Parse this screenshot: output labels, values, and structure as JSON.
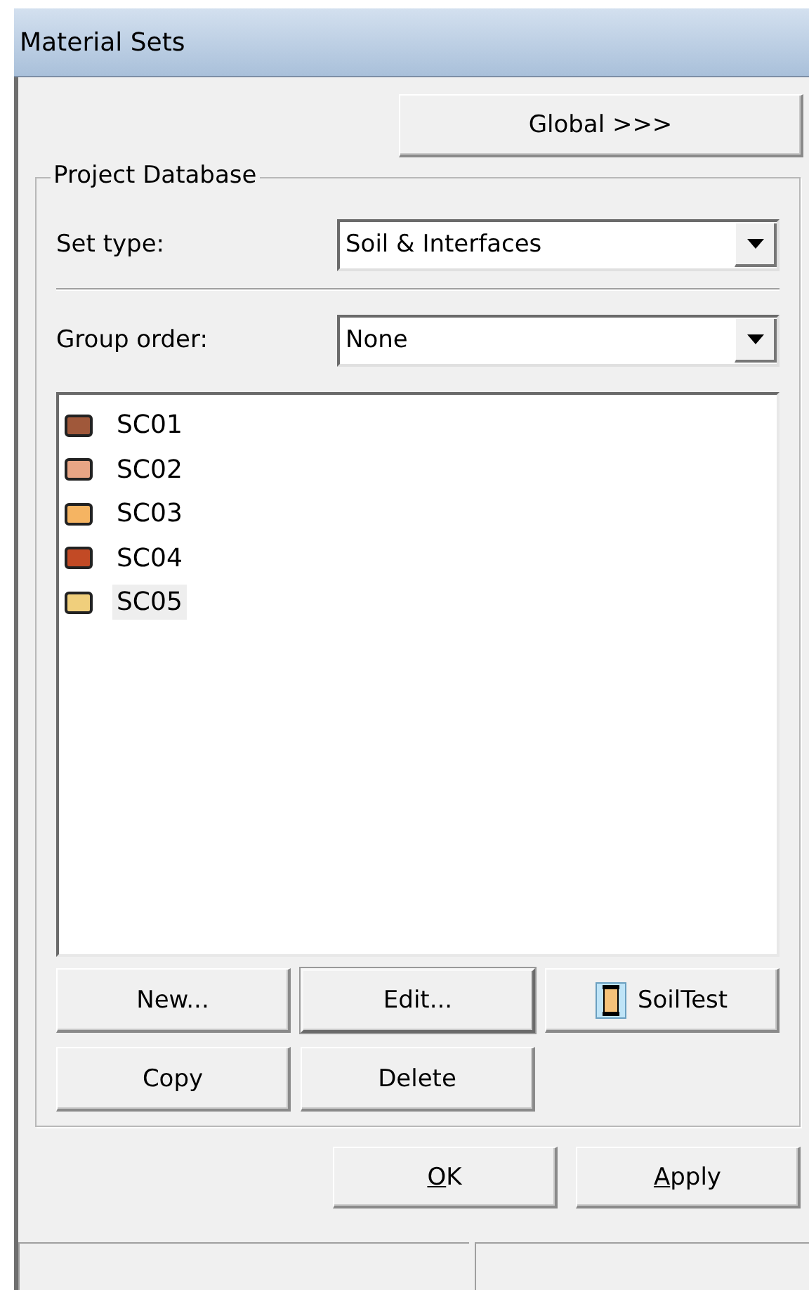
{
  "window": {
    "title": "Material Sets"
  },
  "global_button": "Global >>>",
  "group": {
    "title": "Project Database",
    "set_type": {
      "label": "Set type:",
      "value": "Soil & Interfaces"
    },
    "group_order": {
      "label": "Group order:",
      "value": "None"
    },
    "materials": [
      {
        "name": "SC01",
        "color": "#a0583a",
        "selected": false
      },
      {
        "name": "SC02",
        "color": "#e8a585",
        "selected": false
      },
      {
        "name": "SC03",
        "color": "#f5b462",
        "selected": false
      },
      {
        "name": "SC04",
        "color": "#c24a25",
        "selected": false
      },
      {
        "name": "SC05",
        "color": "#f0cf7c",
        "selected": true
      }
    ],
    "buttons": [
      {
        "label": "New...",
        "kind": "plain",
        "default": false
      },
      {
        "label": "Edit...",
        "kind": "plain",
        "default": true
      },
      {
        "label": "SoilTest",
        "kind": "icon",
        "default": false
      },
      {
        "label": "Copy",
        "kind": "plain",
        "default": false
      },
      {
        "label": "Delete",
        "kind": "plain",
        "default": false
      }
    ]
  },
  "footer_buttons": [
    {
      "label": "OK",
      "underline_first": true
    },
    {
      "label": "Apply",
      "underline_first": true
    }
  ]
}
